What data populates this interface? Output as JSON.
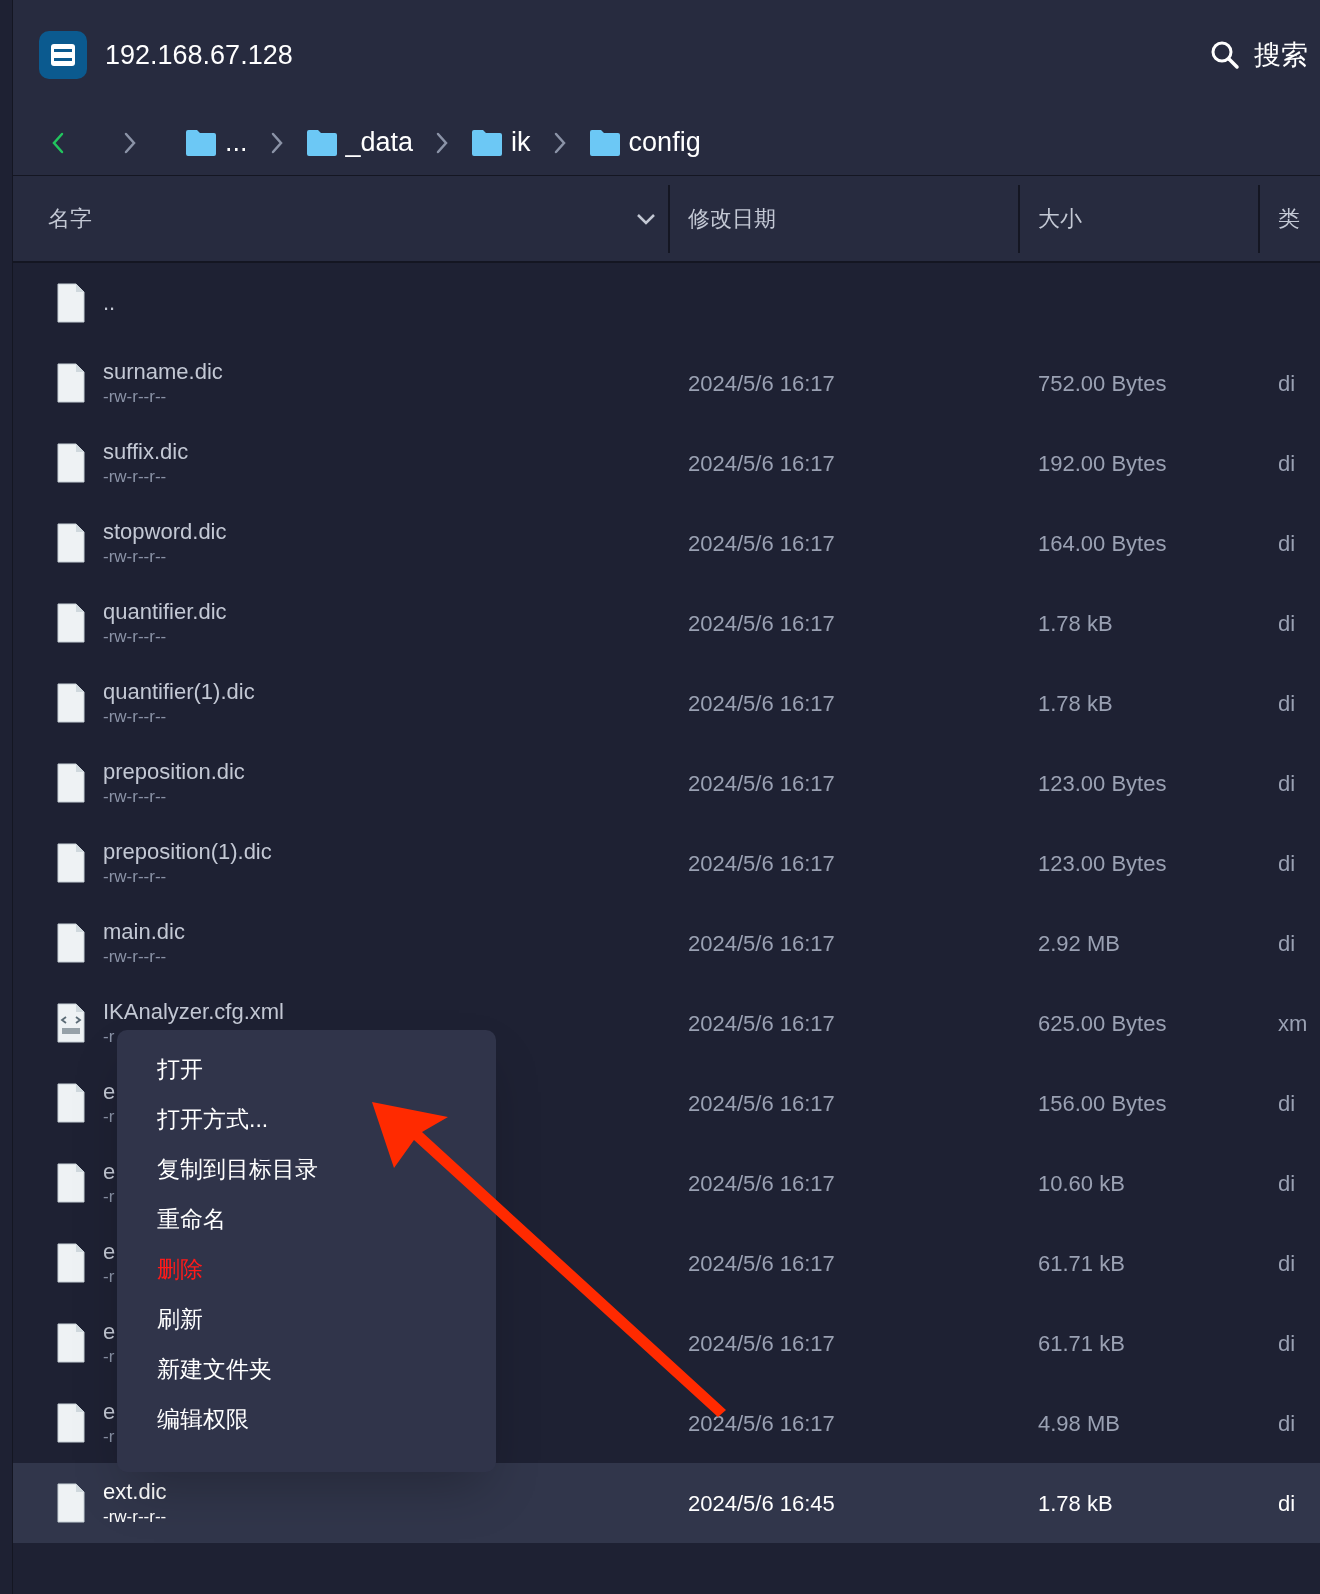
{
  "header": {
    "title": "192.168.67.128",
    "search_label": "搜索"
  },
  "breadcrumb": {
    "back_enabled": true,
    "forward_enabled": false,
    "items": [
      "...",
      "_data",
      "ik",
      "config"
    ]
  },
  "table": {
    "columns": [
      {
        "label": "名字",
        "sorted": true
      },
      {
        "label": "修改日期",
        "sorted": false
      },
      {
        "label": "大小",
        "sorted": false
      },
      {
        "label": "类",
        "sorted": false
      }
    ],
    "rows": [
      {
        "kind": "file",
        "name": "..",
        "perm": "",
        "date": "",
        "size": "",
        "type": "",
        "selected": false
      },
      {
        "kind": "file",
        "name": "surname.dic",
        "perm": "-rw-r--r--",
        "date": "2024/5/6 16:17",
        "size": "752.00 Bytes",
        "type": "di",
        "selected": false
      },
      {
        "kind": "file",
        "name": "suffix.dic",
        "perm": "-rw-r--r--",
        "date": "2024/5/6 16:17",
        "size": "192.00 Bytes",
        "type": "di",
        "selected": false
      },
      {
        "kind": "file",
        "name": "stopword.dic",
        "perm": "-rw-r--r--",
        "date": "2024/5/6 16:17",
        "size": "164.00 Bytes",
        "type": "di",
        "selected": false
      },
      {
        "kind": "file",
        "name": "quantifier.dic",
        "perm": "-rw-r--r--",
        "date": "2024/5/6 16:17",
        "size": "1.78 kB",
        "type": "di",
        "selected": false
      },
      {
        "kind": "file",
        "name": "quantifier(1).dic",
        "perm": "-rw-r--r--",
        "date": "2024/5/6 16:17",
        "size": "1.78 kB",
        "type": "di",
        "selected": false
      },
      {
        "kind": "file",
        "name": "preposition.dic",
        "perm": "-rw-r--r--",
        "date": "2024/5/6 16:17",
        "size": "123.00 Bytes",
        "type": "di",
        "selected": false
      },
      {
        "kind": "file",
        "name": "preposition(1).dic",
        "perm": "-rw-r--r--",
        "date": "2024/5/6 16:17",
        "size": "123.00 Bytes",
        "type": "di",
        "selected": false
      },
      {
        "kind": "file",
        "name": "main.dic",
        "perm": "-rw-r--r--",
        "date": "2024/5/6 16:17",
        "size": "2.92 MB",
        "type": "di",
        "selected": false
      },
      {
        "kind": "xml",
        "name": "IKAnalyzer.cfg.xml",
        "perm": "-r",
        "date": "2024/5/6 16:17",
        "size": "625.00 Bytes",
        "type": "xm",
        "selected": false
      },
      {
        "kind": "file",
        "name": "e",
        "perm": "-r",
        "date": "2024/5/6 16:17",
        "size": "156.00 Bytes",
        "type": "di",
        "selected": false
      },
      {
        "kind": "file",
        "name": "e",
        "perm": "-r",
        "date": "2024/5/6 16:17",
        "size": "10.60 kB",
        "type": "di",
        "selected": false
      },
      {
        "kind": "file",
        "name": "e",
        "perm": "-r",
        "date": "2024/5/6 16:17",
        "size": "61.71 kB",
        "type": "di",
        "selected": false
      },
      {
        "kind": "file",
        "name": "e",
        "perm": "-r",
        "date": "2024/5/6 16:17",
        "size": "61.71 kB",
        "type": "di",
        "selected": false
      },
      {
        "kind": "file",
        "name": "e",
        "perm": "-r",
        "date": "2024/5/6 16:17",
        "size": "4.98 MB",
        "type": "di",
        "selected": false
      },
      {
        "kind": "file",
        "name": "ext.dic",
        "perm": "-rw-r--r--",
        "date": "2024/5/6 16:45",
        "size": "1.78 kB",
        "type": "di",
        "selected": true
      }
    ]
  },
  "context_menu": {
    "items": [
      {
        "label": "打开",
        "danger": false
      },
      {
        "label": "打开方式...",
        "danger": false
      },
      {
        "label": "复制到目标目录",
        "danger": false
      },
      {
        "label": "重命名",
        "danger": false
      },
      {
        "label": "删除",
        "danger": true
      },
      {
        "label": "刷新",
        "danger": false
      },
      {
        "label": "新建文件夹",
        "danger": false
      },
      {
        "label": "编辑权限",
        "danger": false
      }
    ]
  }
}
